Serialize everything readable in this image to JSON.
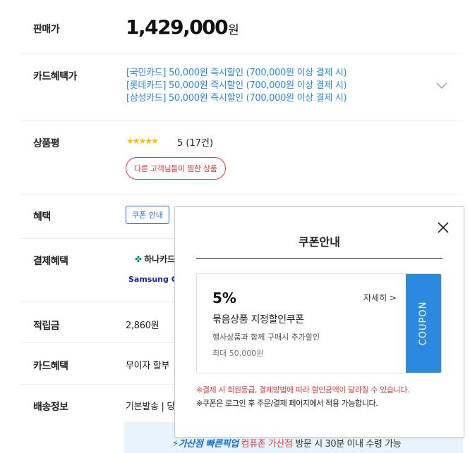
{
  "price": {
    "label": "판매가",
    "amount": "1,429,000",
    "unit": "원"
  },
  "card_benefit": {
    "label": "카드혜택가",
    "lines": [
      "[국민카드] 50,000원 즉시할인 (700,000원 이상 결제 시)",
      "[롯데카드] 50,000원 즉시할인 (700,000원 이상 결제 시)",
      "[삼성카드] 50,000원 즉시할인 (700,000원 이상 결제 시)"
    ]
  },
  "review": {
    "label": "상품평",
    "stars": "★★★★★",
    "rating": "5 (17건)",
    "button": "다른 고객님들이 찜한 상품"
  },
  "benefit": {
    "label": "혜택",
    "coupon_tab": "쿠폰 안내"
  },
  "payment": {
    "label": "결제혜택",
    "hana": "하나카드",
    "samsung": "Samsung Ca"
  },
  "points": {
    "label": "적립금",
    "value": "2,860원"
  },
  "card2": {
    "label": "카드혜택",
    "value": "무이자 할부"
  },
  "shipping": {
    "label": "배송정보",
    "value": "기본발송 | 당"
  },
  "pickup": {
    "brand": "⚡가산점 빠른픽업",
    "place": "컴퓨존 가산점",
    "rest": " 방문 시 30분 이내 수령 가능"
  },
  "modal": {
    "title": "쿠폰안내",
    "coupon": {
      "percent": "5%",
      "detail": "자세히 >",
      "name": "묶음상품 지정할인쿠폰",
      "desc": "행사상품과 함께 구매시 추가할인",
      "max": "최대 50,000원",
      "side": "COUPON"
    },
    "note1": "※결제 시 회원등급, 결제방법에 따라 할인금액이 달라질 수 있습니다.",
    "note2": "※쿠폰은 로그인 후 주문/결제 페이지에서 적용 가능합니다."
  }
}
